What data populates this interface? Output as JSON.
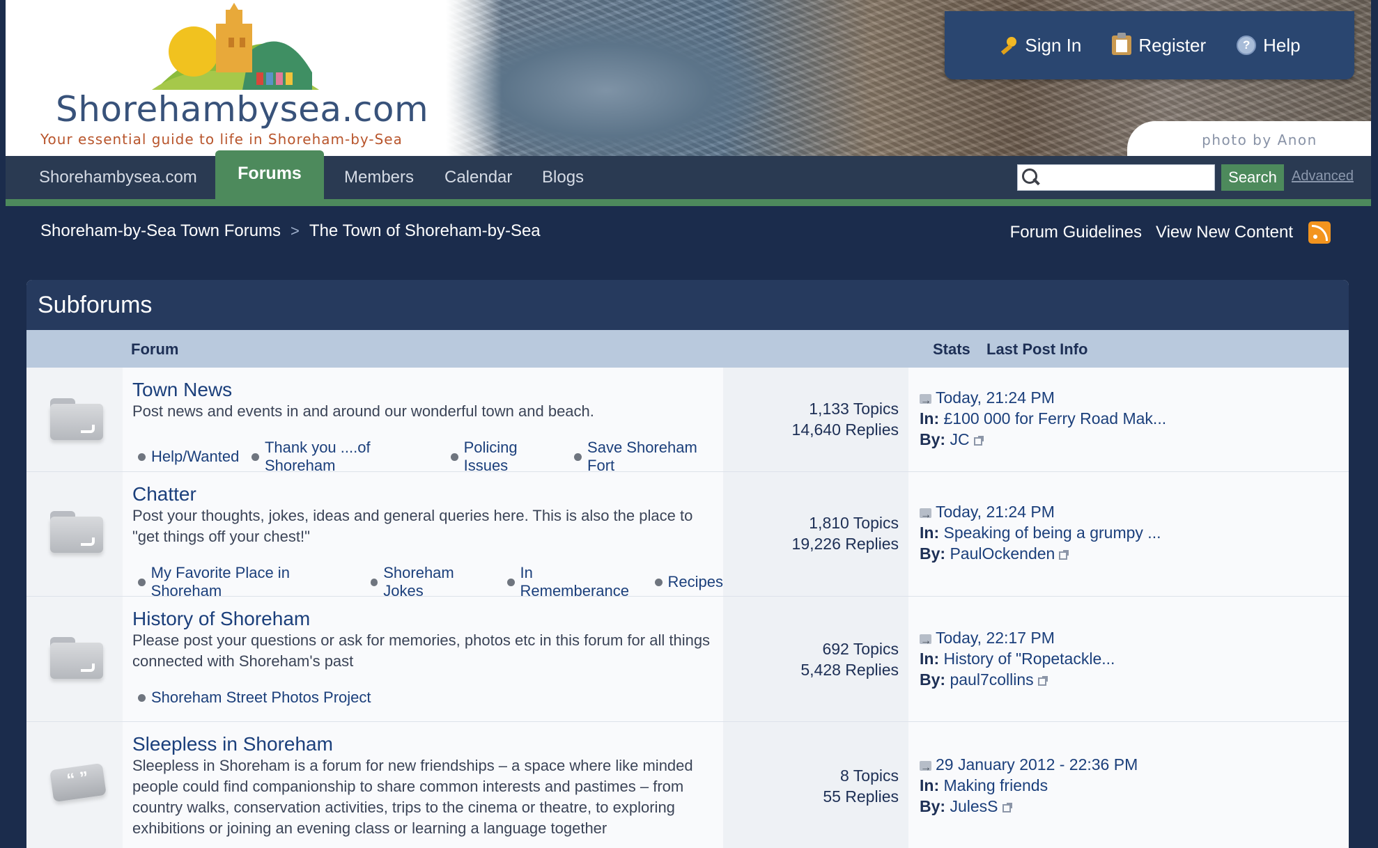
{
  "site": {
    "logo_name": "Shorehambysea.com",
    "logo_tagline": "Your essential guide to life in Shoreham-by-Sea",
    "photo_credit": "photo by Anon"
  },
  "user_panel": {
    "sign_in": "Sign In",
    "register": "Register",
    "help": "Help"
  },
  "nav": {
    "items": [
      "Shorehambysea.com",
      "Forums",
      "Members",
      "Calendar",
      "Blogs"
    ],
    "active": "Forums",
    "search_button": "Search",
    "search_value": "",
    "advanced": "Advanced"
  },
  "breadcrumb": {
    "items": [
      "Shoreham-by-Sea Town Forums",
      "The Town of Shoreham-by-Sea"
    ],
    "separator": ">"
  },
  "top_links": {
    "guidelines": "Forum Guidelines",
    "new_content": "View New Content"
  },
  "panel": {
    "title": "Subforums",
    "columns": {
      "forum": "Forum",
      "stats": "Stats",
      "last_post": "Last Post Info"
    },
    "in_label": "In:",
    "by_label": "By:"
  },
  "forums": [
    {
      "title": "Town News",
      "description": "Post news and events in and around our wonderful town and beach.",
      "subforums": [
        "Help/Wanted",
        "Thank you ....of Shoreham",
        "Policing Issues",
        "Save Shoreham Fort"
      ],
      "topics": "1,133 Topics",
      "replies": "14,640 Replies",
      "last_date": "Today, 21:24 PM",
      "last_in": "£100 000 for Ferry Road Mak...",
      "last_by": "JC",
      "icon": "folder-icon"
    },
    {
      "title": "Chatter",
      "description": "Post your thoughts, jokes, ideas and general queries here. This is also the place to \"get things off your chest!\"",
      "subforums": [
        "My Favorite Place in Shoreham",
        "Shoreham Jokes",
        "In Rememberance",
        "Recipes"
      ],
      "topics": "1,810 Topics",
      "replies": "19,226 Replies",
      "last_date": "Today, 21:24 PM",
      "last_in": "Speaking of being a grumpy ...",
      "last_by": "PaulOckenden",
      "icon": "folder-icon"
    },
    {
      "title": "History of Shoreham",
      "description": "Please post your questions or ask for memories, photos etc in this forum for all things connected with Shoreham's past",
      "subforums": [
        "Shoreham Street Photos Project"
      ],
      "topics": "692 Topics",
      "replies": "5,428 Replies",
      "last_date": "Today, 22:17 PM",
      "last_in": "History of \"Ropetackle...",
      "last_by": "paul7collins",
      "icon": "folder-icon"
    },
    {
      "title": "Sleepless in Shoreham",
      "description": "Sleepless in Shoreham is a forum for new friendships – a space where like minded people could find companionship to share common interests and pastimes – from country walks, conservation activities, trips to the cinema or theatre, to exploring exhibitions or joining an evening class or learning a language together",
      "subforums": [],
      "topics": "8 Topics",
      "replies": "55 Replies",
      "last_date": "29 January 2012 - 22:36 PM",
      "last_in": "Making friends",
      "last_by": "JulesS",
      "icon": "speech-bubble-icon"
    }
  ],
  "colors": {
    "page_bg": "#1b2c4c",
    "nav_bg": "#2a3a52",
    "accent_green": "#4d8a5c",
    "panel_header": "#263a5e",
    "column_header": "#b9c9dd",
    "link": "#1b3f7b"
  }
}
